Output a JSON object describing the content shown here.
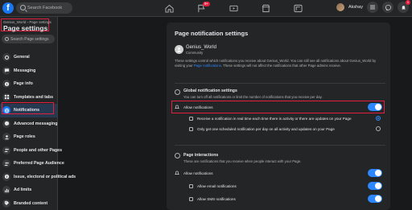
{
  "topbar": {
    "logo": "f",
    "search_placeholder": "Search Facebook",
    "notification_count": "9+",
    "user_name": "Akshay",
    "notif_badge": "1",
    "icons": [
      "home-icon",
      "flag-icon",
      "video-icon",
      "marketplace-icon",
      "groups-icon",
      "menu-icon",
      "messenger-icon",
      "bell-icon"
    ]
  },
  "sidebar": {
    "breadcrumb": "Genius_World › Page settings",
    "title": "Page settings",
    "search_placeholder": "Search Page settings",
    "items": [
      {
        "label": "General",
        "icon": "gear-icon"
      },
      {
        "label": "Messaging",
        "icon": "chat-icon"
      },
      {
        "label": "Page info",
        "icon": "info-icon"
      },
      {
        "label": "Templates and tabs",
        "icon": "grid-icon"
      },
      {
        "label": "Notifications",
        "icon": "globe-icon",
        "active": true
      },
      {
        "label": "Advanced messaging",
        "icon": "messenger-icon"
      },
      {
        "label": "Page roles",
        "icon": "person-icon"
      },
      {
        "label": "People and other Pages",
        "icon": "people-icon"
      },
      {
        "label": "Preferred Page Audience",
        "icon": "people-icon"
      },
      {
        "label": "Issue, electoral or political ads",
        "icon": "info-icon"
      },
      {
        "label": "Ad limits",
        "icon": "chart-icon"
      },
      {
        "label": "Branded content",
        "icon": "tag-icon"
      }
    ]
  },
  "main": {
    "title": "Page notification settings",
    "page_name": "Genius_World",
    "page_category": "Community",
    "intro_before": "These settings control which notifications you receive about Genius_World. You can still see all notifications about Genius_World by visiting your ",
    "intro_link": "Page notifications",
    "intro_after": ". These settings will not affect the notifications that other Page admins receive.",
    "global": {
      "title": "Global notification settings",
      "desc": "You can turn off all notifications or limit the number of notifications that you receive per day.",
      "allow_label": "Allow notifications",
      "allow_on": true,
      "options": [
        {
          "label": "Receive a notification in real time each time there is activity or there are updates on your Page",
          "selected": true
        },
        {
          "label": "Only get one scheduled notification per day on all activity and updates on your Page",
          "selected": false
        }
      ]
    },
    "interactions": {
      "title": "Page interactions",
      "desc": "These are notifications that you receive when people interact with your Page.",
      "allow_label": "Allow notifications",
      "allow_on": true,
      "email_label": "Allow email notifications",
      "email_on": true,
      "sms_label": "Allow SMS notifications",
      "sms_on": true
    }
  },
  "colors": {
    "accent": "#2d88ff",
    "highlight": "#e41e3f",
    "panel": "#242526",
    "background": "#18191a"
  }
}
